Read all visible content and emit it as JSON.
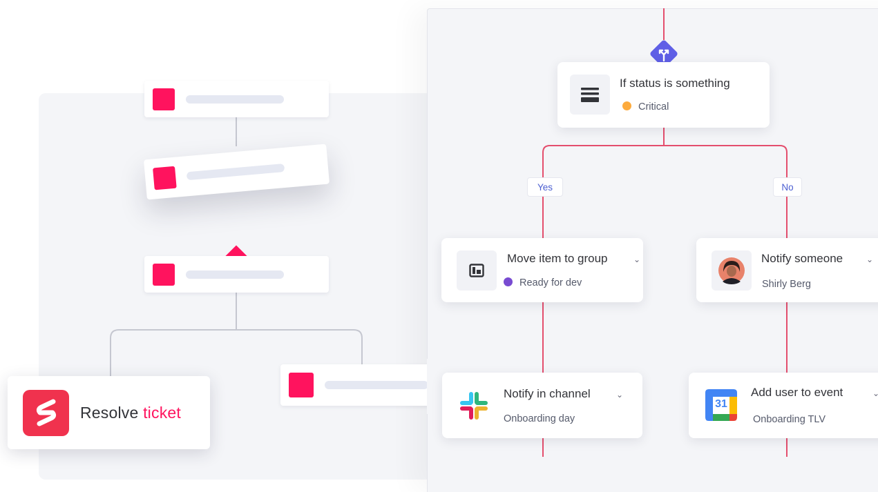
{
  "resolve_card": {
    "prefix": "Resolve",
    "accent": "ticket"
  },
  "condition": {
    "title": "If status is something",
    "status": "Critical",
    "status_color": "#fdab3d"
  },
  "branches": {
    "yes_label": "Yes",
    "no_label": "No"
  },
  "actions": [
    {
      "title": "Move item to group",
      "subtitle": "Ready for dev",
      "dot_color": "#784bd1",
      "icon": "group-icon"
    },
    {
      "title": "Notify someone",
      "subtitle": "Shirly Berg",
      "icon": "avatar"
    },
    {
      "title": "Notify in channel",
      "subtitle": "Onboarding day",
      "icon": "slack-icon"
    },
    {
      "title": "Add user to event",
      "subtitle": "Onboarding TLV",
      "icon": "calendar-icon",
      "calendar_day": "31"
    }
  ],
  "colors": {
    "accent": "#ff135e",
    "flow_line": "#e44e6d",
    "branch_diamond": "#5f5fe6",
    "link_text": "#4b5ed1"
  }
}
